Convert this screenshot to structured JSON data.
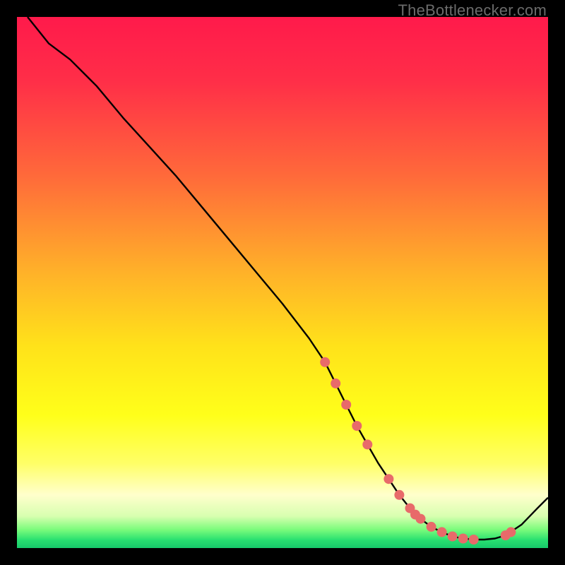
{
  "watermark": "TheBottlenecker.com",
  "gradient": {
    "stops": [
      {
        "offset": 0.0,
        "color": "#ff1a4b"
      },
      {
        "offset": 0.12,
        "color": "#ff2e48"
      },
      {
        "offset": 0.3,
        "color": "#ff6a3a"
      },
      {
        "offset": 0.48,
        "color": "#ffb129"
      },
      {
        "offset": 0.62,
        "color": "#ffe21a"
      },
      {
        "offset": 0.75,
        "color": "#ffff1a"
      },
      {
        "offset": 0.84,
        "color": "#ffff66"
      },
      {
        "offset": 0.9,
        "color": "#ffffcc"
      },
      {
        "offset": 0.94,
        "color": "#d8ffb0"
      },
      {
        "offset": 0.965,
        "color": "#7CFC7C"
      },
      {
        "offset": 0.985,
        "color": "#28e070"
      },
      {
        "offset": 1.0,
        "color": "#17c96b"
      }
    ]
  },
  "chart_data": {
    "type": "line",
    "title": "",
    "xlabel": "",
    "ylabel": "",
    "xlim": [
      0,
      100
    ],
    "ylim": [
      0,
      100
    ],
    "series": [
      {
        "name": "curve",
        "x": [
          2,
          6,
          10,
          15,
          20,
          25,
          30,
          35,
          40,
          45,
          50,
          55,
          58,
          60,
          62,
          64,
          66,
          68,
          70,
          72,
          74,
          76,
          78,
          80,
          82,
          84,
          86,
          88,
          90,
          92,
          95,
          98,
          100
        ],
        "y": [
          100,
          95,
          92,
          87,
          81,
          75.5,
          70,
          64,
          58,
          52,
          46,
          39.5,
          35,
          31,
          27,
          23,
          19.5,
          16,
          13,
          10,
          7.5,
          5.5,
          4,
          3,
          2.2,
          1.8,
          1.6,
          1.6,
          1.8,
          2.4,
          4.4,
          7.5,
          9.5
        ]
      }
    ],
    "markers": {
      "name": "highlight-points",
      "color": "#e86a6a",
      "x": [
        58,
        60,
        62,
        64,
        66,
        70,
        72,
        74,
        75,
        76,
        78,
        80,
        82,
        84,
        86,
        92,
        93
      ],
      "y": [
        35,
        31,
        27,
        23,
        19.5,
        13,
        10,
        7.5,
        6.3,
        5.5,
        4,
        3,
        2.2,
        1.8,
        1.6,
        2.4,
        3.0
      ]
    }
  }
}
